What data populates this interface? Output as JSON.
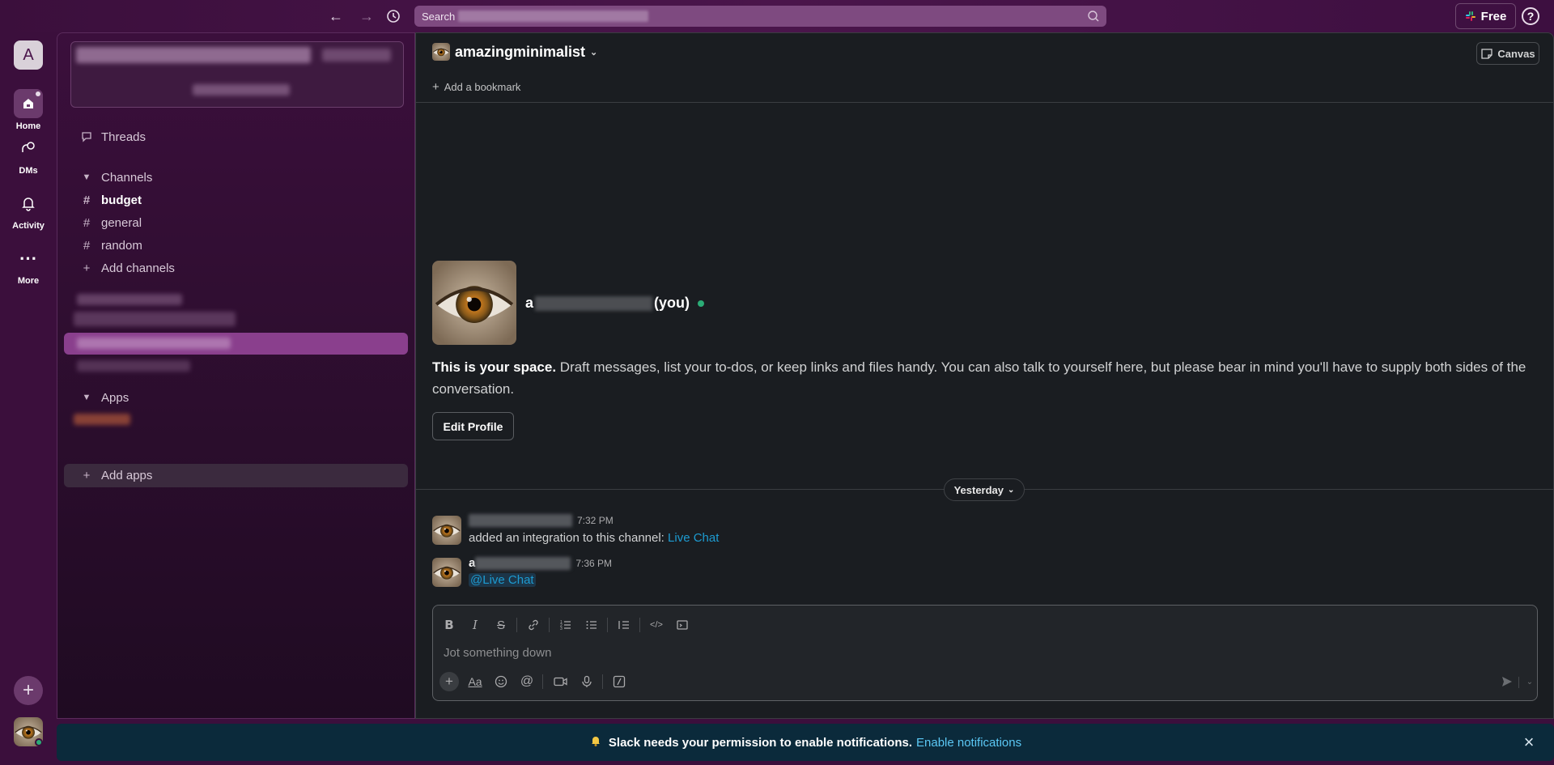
{
  "search": {
    "label": "Search"
  },
  "topbar": {
    "plan_label": "Free",
    "help_label": "?"
  },
  "rail": {
    "workspace_initial": "A",
    "items": [
      {
        "label": "Home"
      },
      {
        "label": "DMs"
      },
      {
        "label": "Activity"
      },
      {
        "label": "More"
      }
    ]
  },
  "sidebar": {
    "threads": "Threads",
    "channels_header": "Channels",
    "channels": [
      "budget",
      "general",
      "random"
    ],
    "add_channels": "Add channels",
    "apps_header": "Apps",
    "add_apps": "Add apps"
  },
  "channel": {
    "name": "amazingminimalist",
    "add_bookmark": "Add a bookmark",
    "canvas_label": "Canvas"
  },
  "profile": {
    "name_prefix": "a",
    "you_label": "(you)",
    "intro_bold": "This is your space.",
    "intro_text": " Draft messages, list your to-dos, or keep links and files handy. You can also talk to yourself here, but please bear in mind you'll have to supply both sides of the conversation.",
    "edit_button": "Edit Profile"
  },
  "day_divider": "Yesterday",
  "messages": [
    {
      "time": "7:32 PM",
      "text": "added an integration to this channel: ",
      "link": "Live Chat"
    },
    {
      "name_prefix": "a",
      "time": "7:36 PM",
      "mention": "@Live Chat"
    }
  ],
  "composer": {
    "placeholder": "Jot something down"
  },
  "notification": {
    "text": "Slack needs your permission to enable notifications.",
    "link": "Enable notifications"
  },
  "colors": {
    "accent": "#4a154b",
    "active": "#8a3f8d",
    "link": "#1d9bd1",
    "presence": "#2bac76"
  }
}
